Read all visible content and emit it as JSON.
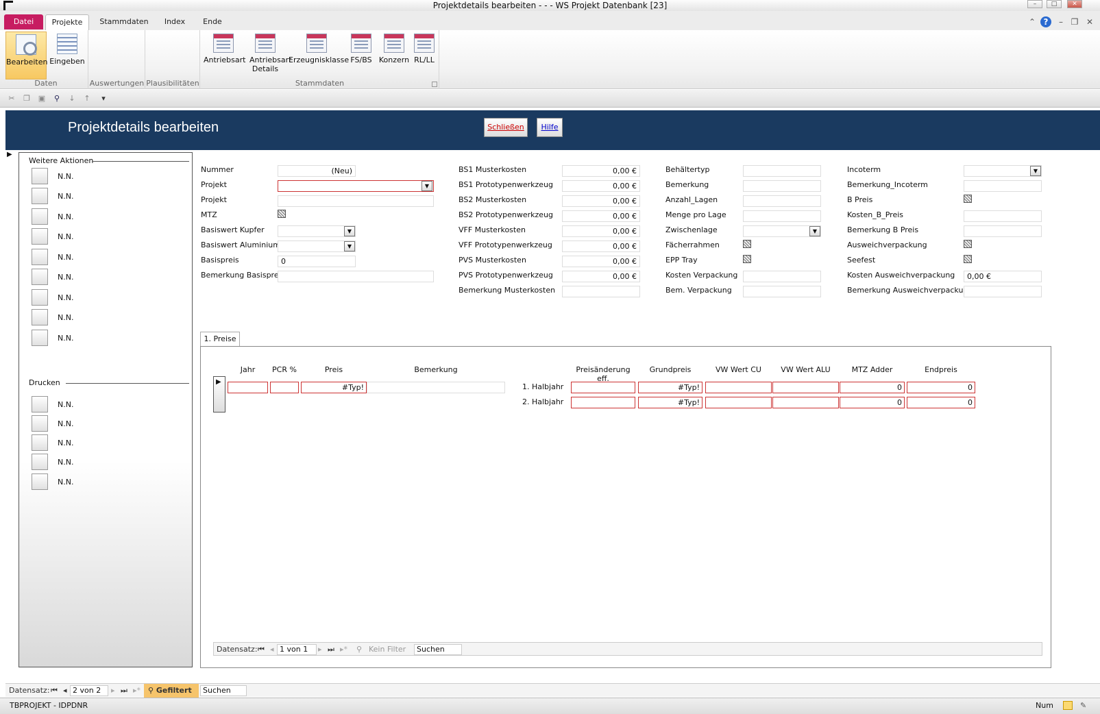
{
  "window": {
    "title": "Projektdetails bearbeiten -  -  -  WS Projekt Datenbank [23]"
  },
  "ribbon": {
    "tabs": [
      "Datei",
      "Projekte",
      "Stammdaten",
      "Index",
      "Ende"
    ],
    "groups": {
      "daten": {
        "label": "Daten",
        "buttons": [
          "Bearbeiten",
          "Eingeben"
        ]
      },
      "auswertungen": {
        "label": "Auswertungen"
      },
      "plausibilitaeten": {
        "label": "Plausibilitäten"
      },
      "stammdaten": {
        "label": "Stammdaten",
        "buttons": [
          "Antriebsart",
          "Antriebsart Details",
          "Erzeugnisklasse",
          "FS/BS",
          "Konzern",
          "RL/LL"
        ]
      }
    }
  },
  "header": {
    "title": "Projektdetails bearbeiten",
    "close_label": "Schließen",
    "help_label": "Hilfe"
  },
  "left_panel": {
    "actions_title": "Weitere Aktionen",
    "actions": [
      "N.N.",
      "N.N.",
      "N.N.",
      "N.N.",
      "N.N.",
      "N.N.",
      "N.N.",
      "N.N.",
      "N.N."
    ],
    "print_title": "Drucken",
    "print": [
      "N.N.",
      "N.N.",
      "N.N.",
      "N.N.",
      "N.N."
    ]
  },
  "col1": {
    "nummer_label": "Nummer",
    "nummer_value": "(Neu)",
    "projekt_label": "Projekt",
    "projekt2_label": "Projekt",
    "mtz_label": "MTZ",
    "kupfer_label": "Basiswert Kupfer",
    "alu_label": "Basiswert Aluminium",
    "basispreis_label": "Basispreis",
    "basispreis_value": "0",
    "bem_basispreis_label": "Bemerkung Basispreis"
  },
  "col2": {
    "labels": [
      "BS1 Musterkosten",
      "BS1 Prototypenwerkzeug",
      "BS2 Musterkosten",
      "BS2 Prototypenwerkzeug",
      "VFF Musterkosten",
      "VFF Prototypenwerkzeug",
      "PVS Musterkosten",
      "PVS Prototypenwerkzeug",
      "Bemerkung Musterkosten"
    ],
    "values": [
      "0,00 €",
      "0,00 €",
      "0,00 €",
      "0,00 €",
      "0,00 €",
      "0,00 €",
      "0,00 €",
      "0,00 €",
      ""
    ]
  },
  "col3": {
    "labels": [
      "Behältertyp",
      "Bemerkung",
      "Anzahl_Lagen",
      "Menge pro Lage",
      "Zwischenlage",
      "Fächerrahmen",
      "EPP Tray",
      "Kosten Verpackung",
      "Bem. Verpackung"
    ]
  },
  "col4": {
    "labels": [
      "Incoterm",
      "Bemerkung_Incoterm",
      "B Preis",
      "Kosten_B_Preis",
      "Bemerkung B Preis",
      "Ausweichverpackung",
      "Seefest",
      "Kosten Ausweichverpackung",
      "Bemerkung Ausweichverpackung"
    ],
    "kosten_ausweich_value": "0,00 €"
  },
  "subform": {
    "tab_label": "1. Preise",
    "left_headers": [
      "Jahr",
      "PCR %",
      "Preis",
      "Bemerkung"
    ],
    "left_row": {
      "preis": "#Typ!"
    },
    "right_headers": [
      "Preisänderung eff.",
      "Grundpreis",
      "VW Wert CU",
      "VW Wert ALU",
      "MTZ Adder",
      "Endpreis"
    ],
    "rows": [
      {
        "label": "1. Halbjahr",
        "grundpreis": "#Typ!",
        "mtz": "0",
        "endpreis": "0"
      },
      {
        "label": "2. Halbjahr",
        "grundpreis": "#Typ!",
        "mtz": "0",
        "endpreis": "0"
      }
    ],
    "nav": {
      "label": "Datensatz:",
      "position": "1 von 1",
      "filter": "Kein Filter",
      "search": "Suchen"
    }
  },
  "main_nav": {
    "label": "Datensatz:",
    "position": "2 von 2",
    "filter": "Gefiltert",
    "search": "Suchen"
  },
  "status": {
    "left": "TBPROJEKT  - IDPDNR",
    "right": "Num"
  }
}
